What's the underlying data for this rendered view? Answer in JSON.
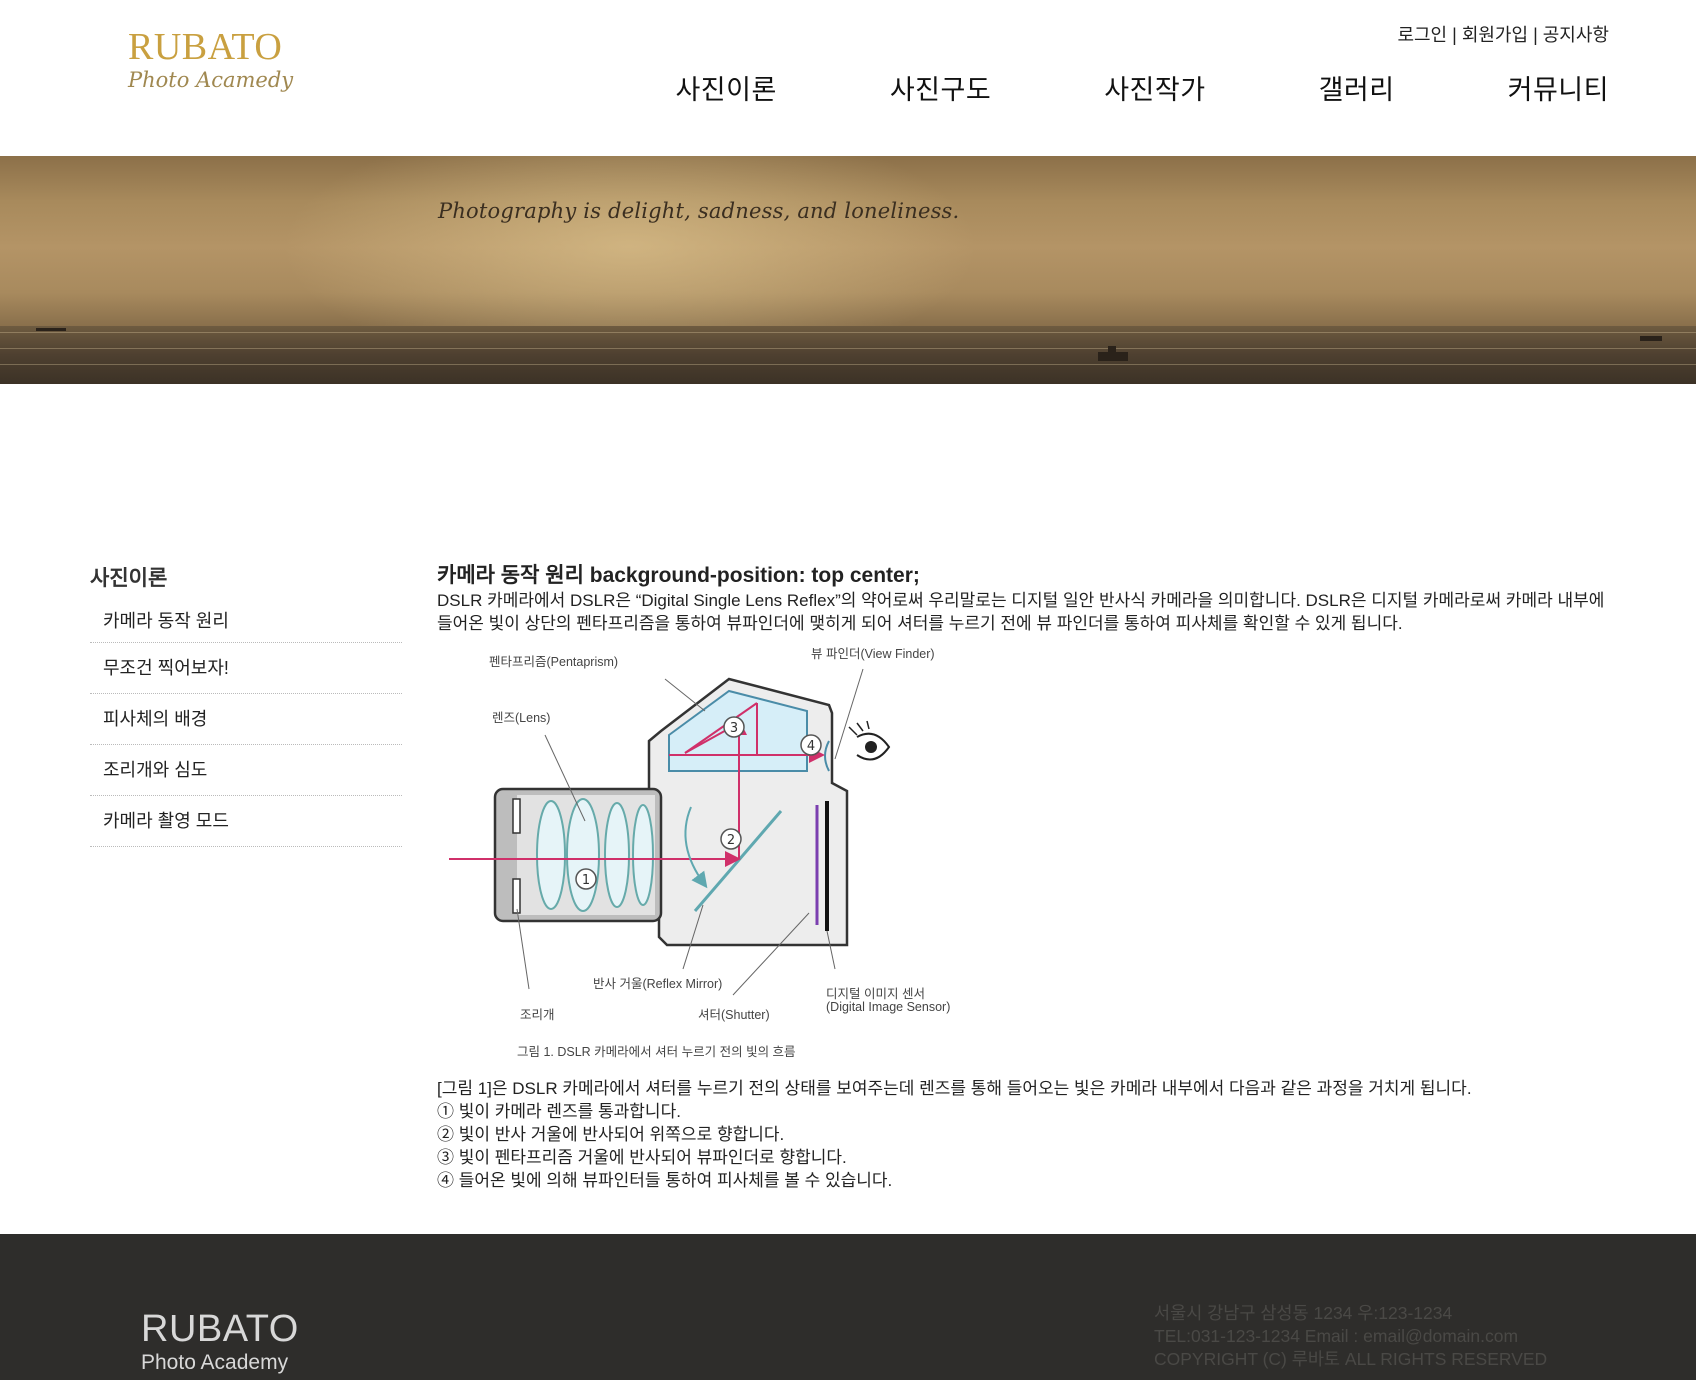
{
  "header": {
    "logo_main": "RUBATO",
    "logo_sub": "Photo Acamedy",
    "util": {
      "login": "로그인",
      "join": "회원가입",
      "notice": "공지사항",
      "separator": "|"
    },
    "gnb": [
      "사진이론",
      "사진구도",
      "사진작가",
      "갤러리",
      "커뮤니티"
    ]
  },
  "banner": {
    "quote": "Photography is delight, sadness, and loneliness."
  },
  "sidebar": {
    "title": "사진이론",
    "items": [
      "카메라 동작 원리",
      "무조건 찍어보자!",
      "피사체의 배경",
      "조리개와 심도",
      "카메라 촬영 모드"
    ]
  },
  "content": {
    "title": "카메라 동작 원리 background-position: top center;",
    "intro": "DSLR 카메라에서 DSLR은 “Digital Single Lens Reflex”의 약어로써 우리말로는 디지털 일안 반사식 카메라을 의미합니다. DSLR은 디지털 카메라로써 카메라 내부에 들어온 빛이 상단의 펜타프리즘을 통하여 뷰파인더에 맺히게 되어 셔터를 누르기 전에 뷰 파인더를 통하여 피사체를 확인할 수 있게 됩니다.",
    "diagram": {
      "labels": {
        "pentaprism": "펜타프리즘(Pentaprism)",
        "viewfinder": "뷰 파인더(View Finder)",
        "lens": "렌즈(Lens)",
        "mirror": "반사 거울(Reflex Mirror)",
        "aperture": "조리개",
        "shutter": "셔터(Shutter)",
        "sensor_ko": "디지털 이미지 센서",
        "sensor_en": "(Digital Image Sensor)"
      },
      "numbers": [
        "1",
        "2",
        "3",
        "4"
      ],
      "caption": "그림 1. DSLR 카메라에서 셔터 누르기 전의 빛의 흐름"
    },
    "steps": [
      "[그림 1]은 DSLR 카메라에서 셔터를 누르기 전의 상태를 보여주는데 렌즈를 통해 들어오는 빛은 카메라 내부에서 다음과 같은 과정을 거치게 됩니다.",
      "① 빛이 카메라 렌즈를 통과합니다.",
      "② 빛이 반사 거울에 반사되어 위쪽으로 향합니다.",
      "③ 빛이 펜타프리즘 거울에 반사되어 뷰파인더로 향합니다.",
      "④ 들어온 빛에 의해 뷰파인터들 통하여 피사체를 볼 수 있습니다."
    ]
  },
  "footer": {
    "logo_main": "RUBATO",
    "logo_sub": "Photo Academy",
    "address": "서울시 강남구 삼성동 1234 우:123-1234",
    "contact": "TEL:031-123-1234 Email : email@domain.com",
    "copyright": "COPYRIGHT (C) 루바토 ALL RIGHTS RESERVED"
  },
  "colors": {
    "brand_gold": "#c9a040",
    "footer_bg": "#2e2d2b",
    "light_ray": "#d0306a",
    "prism_fill": "#d6eef8"
  }
}
